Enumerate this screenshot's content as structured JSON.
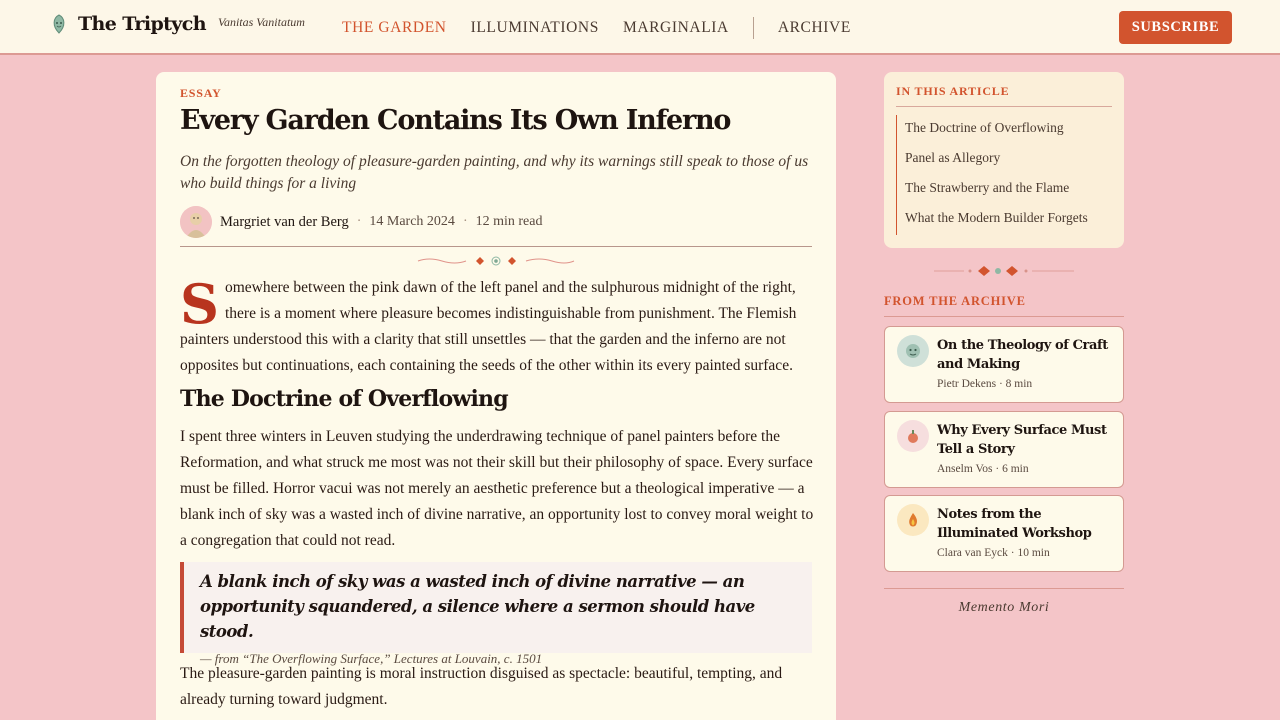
{
  "brand": {
    "title": "The Triptych",
    "tagline": "Vanitas Vanitatum"
  },
  "nav": {
    "items": [
      "THE GARDEN",
      "ILLUMINATIONS",
      "MARGINALIA",
      "ARCHIVE"
    ],
    "active": "THE GARDEN"
  },
  "header": {
    "subscribe_label": "SUBSCRIBE"
  },
  "article": {
    "kicker": "ESSAY",
    "title": "Every Garden Contains Its Own Inferno",
    "dek": "On the forgotten theology of pleasure-garden painting, and why its warnings still speak to those of us who build things for a living",
    "author": "Margriet van der Berg",
    "date": "14 March 2024",
    "read_time": "12 min read",
    "dropcap": "S",
    "p1": "omewhere between the pink dawn of the left panel and the sulphurous midnight of the right, there is a moment where pleasure becomes indistinguishable from punishment. The Flemish painters understood this with a clarity that still unsettles — that the garden and the inferno are not opposites but continuations, each containing the seeds of the other within its every painted surface.",
    "h2": "The Doctrine of Overflowing",
    "p2": "I spent three winters in Leuven studying the underdrawing technique of panel painters before the Reformation, and what struck me most was not their skill but their philosophy of space. Every surface must be filled. Horror vacui was not merely an aesthetic preference but a theological imperative — a blank inch of sky was a wasted inch of divine narrative, an opportunity lost to convey moral weight to a congregation that could not read.",
    "quote": "A blank inch of sky was a wasted inch of divine narrative — an opportunity squandered, a silence where a sermon should have stood.",
    "quote_cite": "— from “The Overflowing Surface,” Lectures at Louvain, c. 1501",
    "p3": "The pleasure-garden painting is moral instruction disguised as spectacle: beautiful, tempting, and already turning toward judgment."
  },
  "toc": {
    "heading": "IN THIS ARTICLE",
    "items": [
      "The Doctrine of Overflowing",
      "Panel as Allegory",
      "The Strawberry and the Flame",
      "What the Modern Builder Forgets"
    ]
  },
  "archive": {
    "heading": "FROM THE ARCHIVE",
    "cards": [
      {
        "title": "On the Theology of Craft and Making",
        "meta": "Pietr Dekens · 8 min",
        "icon": "face-icon"
      },
      {
        "title": "Why Every Surface Must Tell a Story",
        "meta": "Anselm Vos · 6 min",
        "icon": "fruit-icon"
      },
      {
        "title": "Notes from the Illuminated Workshop",
        "meta": "Clara van Eyck · 10 min",
        "icon": "flame-icon"
      }
    ]
  },
  "footer": {
    "motto": "Memento Mori"
  },
  "colors": {
    "accent": "#d2542e",
    "background": "#f4c5c8",
    "paper": "#fefaea",
    "dropcap": "#b8341e"
  }
}
